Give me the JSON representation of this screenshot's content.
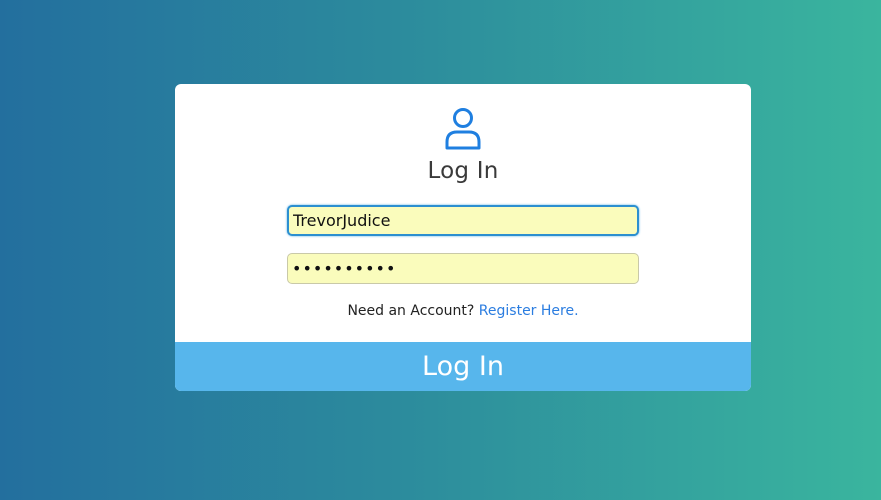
{
  "form": {
    "title": "Log In",
    "icon": "user-icon",
    "accent_color": "#1f7fe0",
    "username": {
      "value": "TrevorJudice"
    },
    "password": {
      "value": "••••••••••"
    },
    "register_prompt": "Need an Account?",
    "register_link": "Register Here.",
    "submit_label": "Log In"
  }
}
